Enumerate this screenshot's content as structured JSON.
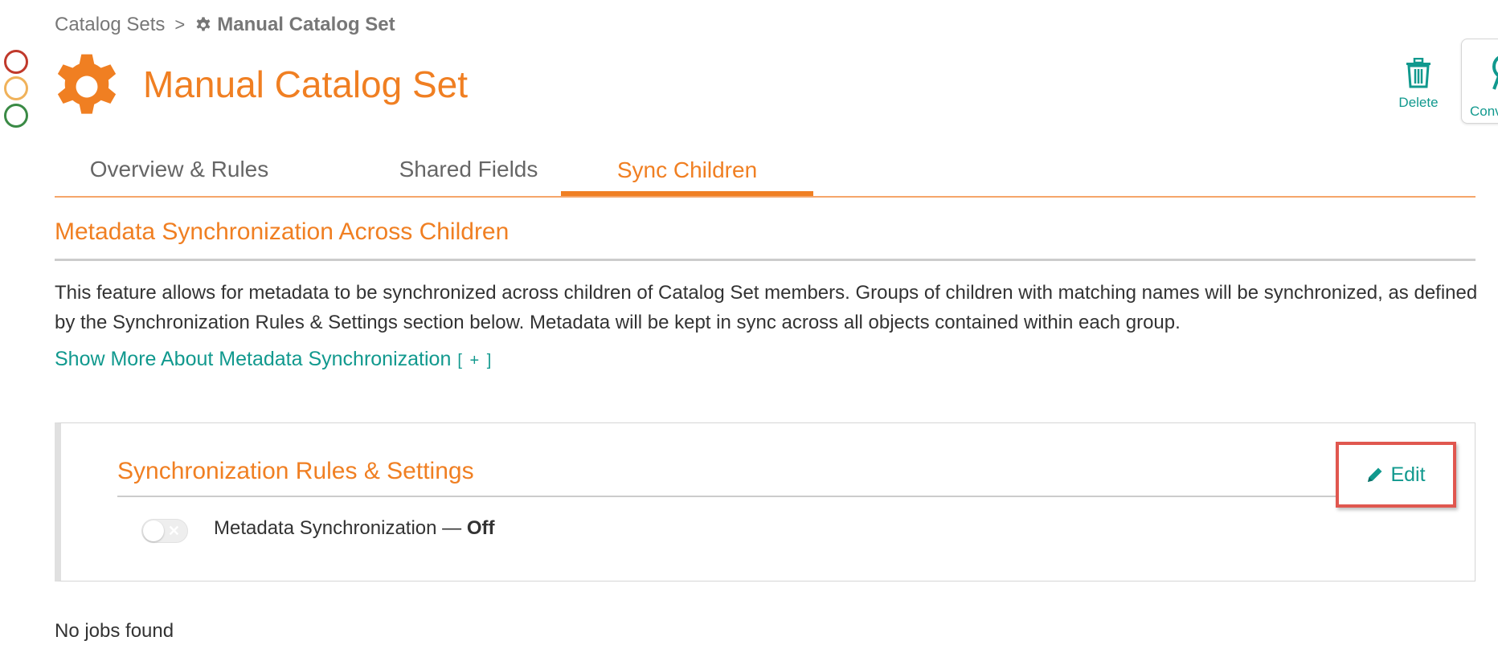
{
  "status_circles": [
    {
      "name": "red",
      "color": "#c0392b"
    },
    {
      "name": "yellow",
      "color": "#f0b25a"
    },
    {
      "name": "green",
      "color": "#3a8a45"
    }
  ],
  "breadcrumb": {
    "parent": "Catalog Sets",
    "separator": ">",
    "current": "Manual Catalog Set"
  },
  "header": {
    "title": "Manual Catalog Set",
    "actions": {
      "delete_label": "Delete",
      "conv_label": "Conv"
    }
  },
  "tabs": [
    {
      "label": "Overview & Rules",
      "active": false
    },
    {
      "label": "Shared Fields",
      "active": false
    },
    {
      "label": "Sync Children",
      "active": true
    }
  ],
  "section": {
    "title": "Metadata Synchronization Across Children",
    "description": "This feature allows for metadata to be synchronized across children of Catalog Set members. Groups of children with matching names will be synchronized, as defined by the Synchronization Rules & Settings section below. Metadata will be kept in sync across all objects contained within each group.",
    "show_more_label": "Show More About Metadata Synchronization",
    "show_more_toggle": "[ + ]"
  },
  "settings_card": {
    "title": "Synchronization Rules & Settings",
    "edit_label": "Edit",
    "toggle_state": "off",
    "toggle_label": "Metadata Synchronization",
    "dash": "—",
    "state_text": "Off"
  },
  "jobs": {
    "empty_text": "No jobs found"
  },
  "colors": {
    "accent_orange": "#f07f22",
    "accent_teal": "#11998e",
    "highlight_red": "#e0574f"
  }
}
